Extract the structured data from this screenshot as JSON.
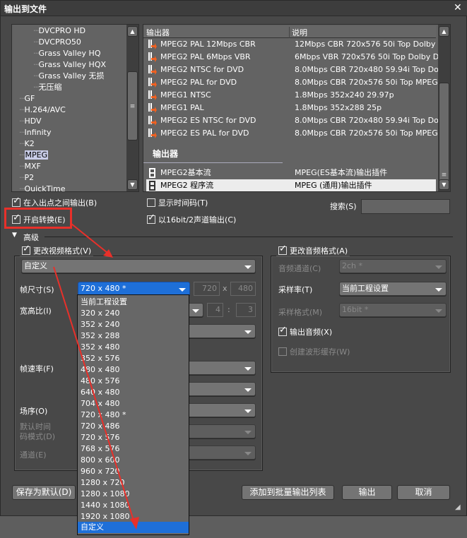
{
  "title": "输出到文件",
  "tree": {
    "items": [
      "DVCPRO HD",
      "DVCPRO50",
      "Grass Valley HQ",
      "Grass Valley HQX",
      "Grass Valley 无损",
      "无压缩",
      "GF",
      "H.264/AVC",
      "HDV",
      "Infinity",
      "K2",
      "MPEG",
      "MXF",
      "P2",
      "QuickTime"
    ],
    "selected": "MPEG"
  },
  "list": {
    "col_name": "输出器",
    "col_desc": "说明",
    "presets": [
      {
        "name": "MPEG2 PAL 12Mbps CBR",
        "desc": "12Mbps CBR 720x576 50i Top Dolby ..."
      },
      {
        "name": "MPEG2 PAL 6Mbps VBR",
        "desc": "6Mbps VBR 720x576 50i Top Dolby Di..."
      },
      {
        "name": "MPEG2 NTSC for DVD",
        "desc": "8.0Mbps CBR 720x480 59.94i Top Dol..."
      },
      {
        "name": "MPEG2 PAL for DVD",
        "desc": "8.0Mbps CBR 720x576 50i Top MPEG..."
      },
      {
        "name": "MPEG1 NTSC",
        "desc": "1.8Mbps 352x240 29.97p"
      },
      {
        "name": "MPEG1 PAL",
        "desc": "1.8Mbps 352x288 25p"
      },
      {
        "name": "MPEG2 ES NTSC for DVD",
        "desc": "8.0Mbps CBR 720x480 59.94i Top Dol..."
      },
      {
        "name": "MPEG2 ES PAL for DVD",
        "desc": "8.0Mbps CBR 720x576 50i Top MPEG..."
      }
    ],
    "section": "输出器",
    "exporters": [
      {
        "name": "MPEG2基本流",
        "desc": "MPEG(ES基本流)输出插件"
      },
      {
        "name": "MPEG2 程序流",
        "desc": "MPEG (通用)输出插件",
        "selected": true
      }
    ]
  },
  "options": {
    "inout": "在入出点之间输出(B)",
    "timecode": "显示时间码(T)",
    "search_label": "搜索(S)",
    "search_value": "",
    "convert": "开启转换(E)",
    "bit16": "以16bit/2声道输出(C)"
  },
  "advanced": "高级",
  "video": {
    "header": "更改视频格式(V)",
    "preset": "自定义",
    "frame_size_label": "帧尺寸(S)",
    "frame_size": "720 x 480 *",
    "width": "720",
    "x": "x",
    "height": "480",
    "aspect_label": "宽高比(I)",
    "aspect_w": "4",
    "colon": ":",
    "aspect_h": "3",
    "fps_label": "帧速率(F)",
    "field_label": "场序(O)",
    "tc_label1": "默认时间",
    "tc_label2": "码模式(D)",
    "channel_label": "通道(E)"
  },
  "audio": {
    "header": "更改音频格式(A)",
    "channel_label": "音频通道(C)",
    "channel": "2ch *",
    "rate_label": "采样率(T)",
    "rate": "当前工程设置",
    "format_label": "采样格式(M)",
    "format": "16bit *",
    "output_audio": "输出音频(X)",
    "waveform": "创建波形缓存(W)"
  },
  "dropdown": {
    "options": [
      "当前工程设置",
      "320 x 240",
      "352 x 240",
      "352 x 288",
      "352 x 480",
      "352 x 576",
      "480 x 480",
      "480 x 576",
      "640 x 480",
      "704 x 480",
      "720 x 480 *",
      "720 x 486",
      "720 x 576",
      "768 x 576",
      "800 x 600",
      "960 x 720",
      "1280 x 720",
      "1280 x 1080",
      "1440 x 1080",
      "1920 x 1080",
      "自定义"
    ],
    "highlighted": "自定义"
  },
  "buttons": {
    "save_default": "保存为默认(D)",
    "add_batch": "添加到批量输出列表",
    "export": "输出",
    "cancel": "取消"
  },
  "colors": {
    "annotation": "#e8302a",
    "highlight": "#1e6fd8"
  }
}
